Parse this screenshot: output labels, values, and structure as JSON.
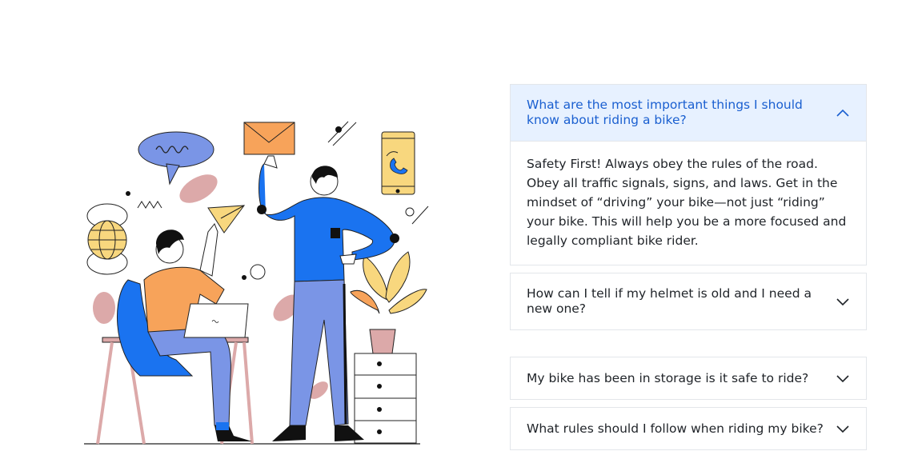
{
  "faq": {
    "items": [
      {
        "question": "What are the most important things I should know about riding a bike?",
        "answer": "Safety First! Always obey the rules of the road. Obey all traffic signals, signs, and laws. Get in the mindset of “driving” your bike—not just “riding” your bike. This will help you be a more focused and legally compliant bike rider.",
        "expanded": true
      },
      {
        "question": "How can I tell if my helmet is old and I need a new one?",
        "expanded": false
      },
      {
        "question": "My bike has been in storage is it safe to ride?",
        "expanded": false
      },
      {
        "question": "What rules should I follow when riding my bike?",
        "expanded": false
      }
    ]
  },
  "colors": {
    "accent": "#1a5fd0",
    "open_header_bg": "#e7f1ff",
    "border": "#e3e6ea",
    "text": "#1f2328",
    "illustration_blue": "#1a73f0",
    "illustration_orange": "#f7a35a",
    "illustration_periwinkle": "#7a95e6",
    "illustration_pink": "#dca9a9",
    "illustration_yellow": "#f8d77e"
  }
}
